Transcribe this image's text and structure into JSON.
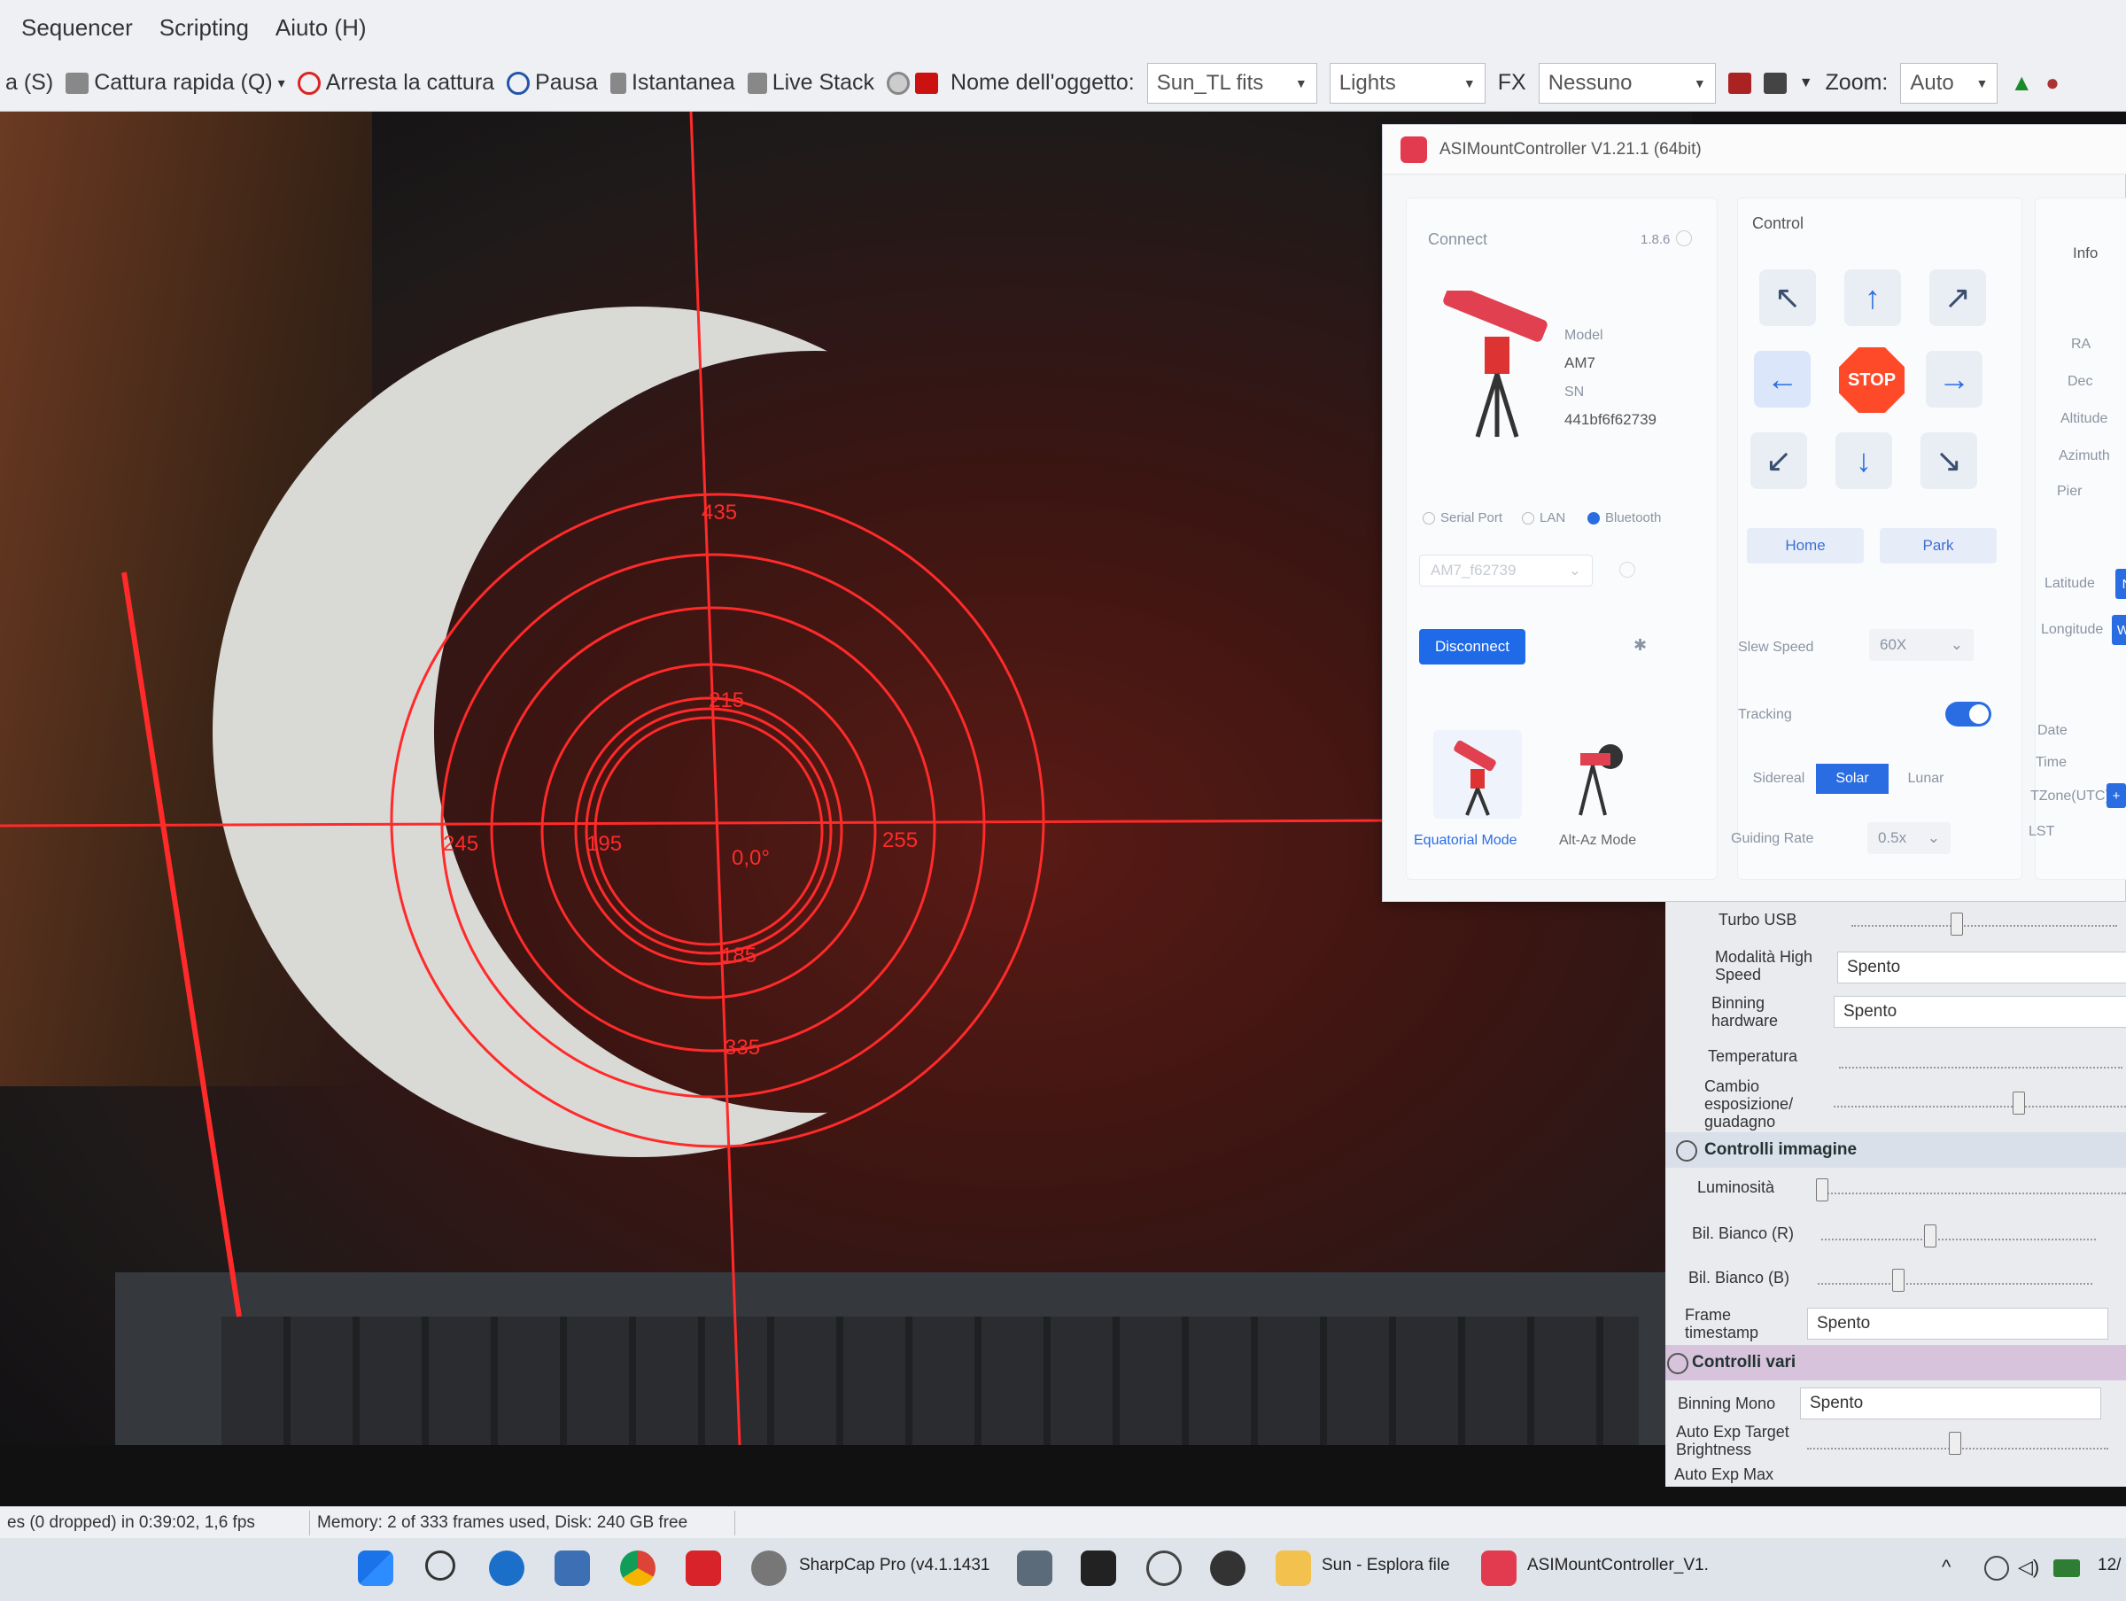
{
  "menubar": {
    "items": [
      "Sequencer",
      "Scripting",
      "Aiuto (H)"
    ]
  },
  "toolbar": {
    "partial_left": "a (S)",
    "quick_capture": "Cattura rapida (Q)",
    "stop_capture": "Arresta la cattura",
    "pause": "Pausa",
    "snapshot": "Istantanea",
    "live_stack": "Live Stack",
    "object_name_label": "Nome dell'oggetto:",
    "object_name_value": "Sun_TL fits",
    "frame_type_value": "Lights",
    "fx_label": "FX",
    "fx_value": "Nessuno",
    "zoom_label": "Zoom:",
    "zoom_value": "Auto"
  },
  "reticle": {
    "labels": [
      "435",
      "215",
      "195",
      "255",
      "0,0°",
      "185",
      "335",
      "245"
    ]
  },
  "mount": {
    "title": "ASIMountController V1.21.1 (64bit)",
    "connect": {
      "title": "Connect",
      "version": "1.8.6",
      "model_label": "Model",
      "model_value": "AM7",
      "sn_label": "SN",
      "sn_value": "441bf6f62739",
      "conn_serial": "Serial Port",
      "conn_lan": "LAN",
      "conn_bluetooth": "Bluetooth",
      "device_select": "AM7_f62739",
      "disconnect": "Disconnect",
      "equatorial_mode": "Equatorial Mode",
      "altaz_mode": "Alt-Az Mode"
    },
    "control": {
      "title": "Control",
      "stop": "STOP",
      "home": "Home",
      "park": "Park",
      "slew_speed_label": "Slew Speed",
      "slew_speed_value": "60X",
      "tracking_label": "Tracking",
      "tracking_on": true,
      "sidereal": "Sidereal",
      "solar": "Solar",
      "lunar": "Lunar",
      "guiding_rate_label": "Guiding Rate",
      "guiding_rate_value": "0.5x"
    },
    "info": {
      "title": "Info",
      "ra": "RA",
      "dec": "Dec",
      "altitude": "Altitude",
      "azimuth": "Azimuth",
      "pier": "Pier",
      "latitude": "Latitude",
      "latitude_badge": "N",
      "longitude": "Longitude",
      "longitude_badge": "W",
      "date": "Date",
      "time": "Time",
      "tzone": "TZone(UTC)",
      "tzone_plus": "+",
      "lst": "LST"
    }
  },
  "controls": {
    "turbo_usb": "Turbo USB",
    "high_speed_label": "Modalità High Speed",
    "high_speed_value": "Spento",
    "binning_hw_label": "Binning hardware",
    "binning_hw_value": "Spento",
    "temperature": "Temperatura",
    "exposure_change": "Cambio esposizione/ guadagno",
    "image_controls": "Controlli immagine",
    "brightness": "Luminosità",
    "wb_red": "Bil. Bianco (R)",
    "wb_blue": "Bil. Bianco (B)",
    "frame_timestamp_label": "Frame timestamp",
    "frame_timestamp_value": "Spento",
    "misc_controls": "Controlli vari",
    "binning_mono_label": "Binning Mono",
    "binning_mono_value": "Spento",
    "auto_exp_target": "Auto Exp Target Brightness",
    "auto_exp_max": "Auto Exp Max"
  },
  "statusbar": {
    "frames": "es (0 dropped) in 0:39:02, 1,6 fps",
    "memory": "Memory: 2 of 333 frames used, Disk: 240 GB free"
  },
  "taskbar": {
    "sharpcap": "SharpCap Pro (v4.1.1431",
    "explorer": "Sun - Esplora file",
    "mountctl": "ASIMountController_V1.",
    "clock": "12/"
  },
  "colors": {
    "reticle": "#ff2a2a",
    "accent": "#2a6de3",
    "stop": "#ff4a2a"
  }
}
